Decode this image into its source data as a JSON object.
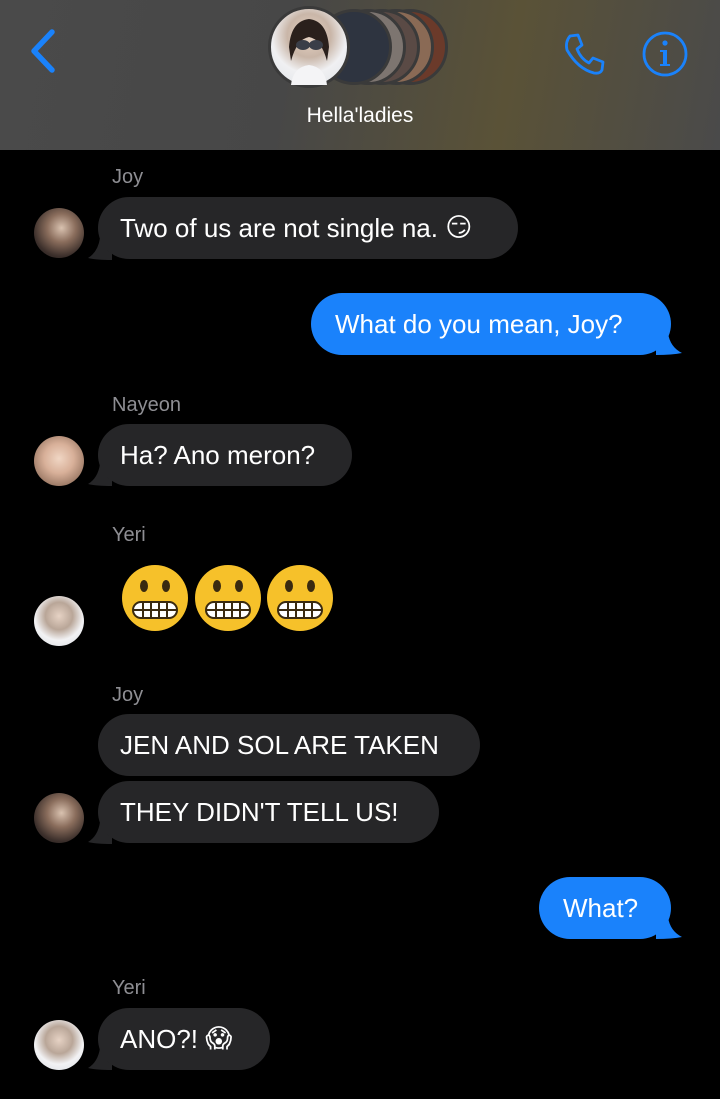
{
  "header": {
    "group_name": "Hella'ladies",
    "accent": "#1a82fb"
  },
  "messages": [
    {
      "sender": "Joy",
      "text": "Two of us are not single na.",
      "emoji": "😏",
      "direction": "incoming"
    },
    {
      "text": "What do you mean, Joy?",
      "direction": "outgoing"
    },
    {
      "sender": "Nayeon",
      "text": "Ha? Ano meron?",
      "direction": "incoming"
    },
    {
      "sender": "Yeri",
      "emoji_only": "😬😬😬",
      "direction": "incoming"
    },
    {
      "sender": "Joy",
      "text": "JEN AND SOL ARE TAKEN",
      "direction": "incoming"
    },
    {
      "text": "THEY DIDN'T TELL US!",
      "direction": "incoming"
    },
    {
      "text": "What?",
      "direction": "outgoing"
    },
    {
      "sender": "Yeri",
      "text": "ANO?!",
      "emoji": "😱",
      "direction": "incoming"
    }
  ],
  "icons": {
    "back": "chevron-left-icon",
    "call": "phone-icon",
    "info": "info-icon"
  }
}
